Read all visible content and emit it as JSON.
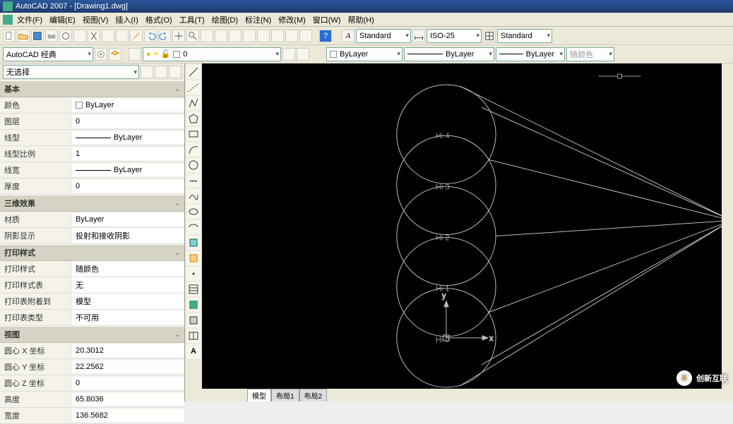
{
  "title": "AutoCAD 2007 - [Drawing1.dwg]",
  "menu": [
    "文件(F)",
    "编辑(E)",
    "视图(V)",
    "插入(I)",
    "格式(O)",
    "工具(T)",
    "绘图(D)",
    "标注(N)",
    "修改(M)",
    "窗口(W)",
    "帮助(H)"
  ],
  "toolbar2": {
    "workspace": "AutoCAD 经典",
    "layer_state": "0",
    "linetype_combo": "ByLayer",
    "lineweight_combo": "ByLayer",
    "linetype2_combo": "ByLayer",
    "plotstyle_combo": "随颜色",
    "text_style": "Standard",
    "dim_style": "ISO-25",
    "table_style": "Standard"
  },
  "props_panel": {
    "selector": "无选择",
    "sections": {
      "basic": {
        "title": "基本",
        "rows": [
          {
            "label": "颜色",
            "value": "ByLayer",
            "swatch": true
          },
          {
            "label": "图层",
            "value": "0"
          },
          {
            "label": "线型",
            "value": "ByLayer",
            "line": true
          },
          {
            "label": "线型比例",
            "value": "1"
          },
          {
            "label": "线宽",
            "value": "ByLayer",
            "line": true
          },
          {
            "label": "厚度",
            "value": "0"
          }
        ]
      },
      "threeD": {
        "title": "三维效果",
        "rows": [
          {
            "label": "材质",
            "value": "ByLayer"
          },
          {
            "label": "阴影显示",
            "value": "投射和接收阴影"
          }
        ]
      },
      "plot": {
        "title": "打印样式",
        "rows": [
          {
            "label": "打印样式",
            "value": "随颜色"
          },
          {
            "label": "打印样式表",
            "value": "无"
          },
          {
            "label": "打印表附着到",
            "value": "模型"
          },
          {
            "label": "打印表类型",
            "value": "不可用"
          }
        ]
      },
      "view": {
        "title": "视图",
        "rows": [
          {
            "label": "圆心 X 坐标",
            "value": "20.3012"
          },
          {
            "label": "圆心 Y 坐标",
            "value": "22.2562"
          },
          {
            "label": "圆心 Z 坐标",
            "value": "0"
          },
          {
            "label": "高度",
            "value": "65.8036"
          },
          {
            "label": "宽度",
            "value": "136.5682"
          }
        ]
      }
    }
  },
  "canvas_labels": [
    "Hi 4",
    "Hi 3",
    "Hi 2",
    "Hi 1",
    "Hi 0"
  ],
  "ucs": {
    "x": "x",
    "y": "y"
  },
  "tabs": [
    "模型",
    "布局1",
    "布局2"
  ],
  "watermark": "创新互联",
  "watermark_initial": "X"
}
